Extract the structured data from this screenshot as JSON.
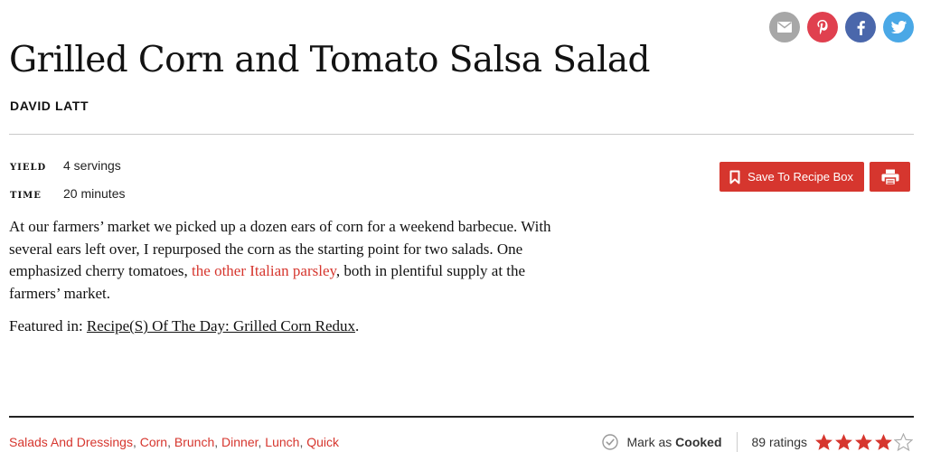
{
  "share": {
    "email_color": "#a7a7a7",
    "pinterest_color": "#e0404f",
    "facebook_color": "#4a67ab",
    "twitter_color": "#4aa8e6"
  },
  "recipe": {
    "title": "Grilled Corn and Tomato Salsa Salad",
    "author": "DAVID LATT",
    "yield_label": "YIELD",
    "yield_value": "4 servings",
    "time_label": "TIME",
    "time_value": "20 minutes",
    "intro_part1": "At our farmers’ market we picked up a dozen ears of corn for a weekend barbecue. With several ears left over, I repurposed the corn as the starting point for two salads. One emphasized cherry tomatoes, ",
    "intro_link": "the other Italian parsley",
    "intro_part2": ", both in plentiful supply at the farmers’ market.",
    "featured_prefix": "Featured in: ",
    "featured_link": "Recipe(S) Of The Day: Grilled Corn Redux",
    "featured_suffix": "."
  },
  "actions": {
    "save_label": "Save To Recipe Box",
    "accent_color": "#d6362e"
  },
  "tags": [
    "Salads And Dressings",
    "Corn",
    "Brunch",
    "Dinner",
    "Lunch",
    "Quick"
  ],
  "tag_separator": ", ",
  "footer": {
    "mark_prefix": "Mark as ",
    "mark_bold": "Cooked",
    "ratings_text": "89 ratings",
    "star_rating": 4,
    "star_max": 5
  }
}
